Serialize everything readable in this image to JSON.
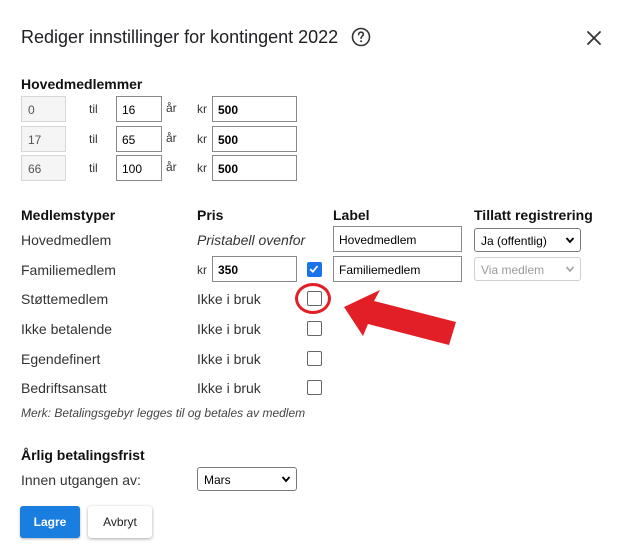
{
  "dialog": {
    "title": "Rediger innstillinger for kontingent 2022",
    "close_icon": "close-icon",
    "help_icon": "help-circle-icon"
  },
  "main_members": {
    "heading": "Hovedmedlemmer",
    "rows": [
      {
        "from": "0",
        "til": "til",
        "to": "16",
        "unit": "år",
        "currency": "kr",
        "price": "500"
      },
      {
        "from": "17",
        "til": "til",
        "to": "65",
        "unit": "år",
        "currency": "kr",
        "price": "500"
      },
      {
        "from": "66",
        "til": "til",
        "to": "100",
        "unit": "år",
        "currency": "kr",
        "price": "500"
      }
    ]
  },
  "types": {
    "headers": {
      "type": "Medlemstyper",
      "price": "Pris",
      "label": "Label",
      "registration": "Tillatt registrering"
    },
    "rows": [
      {
        "name": "Hovedmedlem",
        "price": "Pristabell ovenfor",
        "label": "Hovedmedlem",
        "registration": "Ja (offentlig)",
        "checked": null
      },
      {
        "name": "Familiemedlem",
        "currency": "kr",
        "price": "350",
        "label": "Familiemedlem",
        "registration": "Via medlem",
        "checked": true
      },
      {
        "name": "Støttemedlem",
        "price": "Ikke i bruk",
        "checked": false
      },
      {
        "name": "Ikke betalende",
        "price": "Ikke i bruk",
        "checked": false
      },
      {
        "name": "Egendefinert",
        "price": "Ikke i bruk",
        "checked": false
      },
      {
        "name": "Bedriftsansatt",
        "price": "Ikke i bruk",
        "checked": false
      }
    ],
    "note": "Merk: Betalingsgebyr legges til og betales av medlem"
  },
  "deadline": {
    "heading": "Årlig betalingsfrist",
    "label": "Innen utgangen av:",
    "selected": "Mars"
  },
  "actions": {
    "save": "Lagre",
    "cancel": "Avbryt"
  },
  "colors": {
    "primary": "#1a7ee0",
    "checkbox_checked": "#1a73e8",
    "annotation": "#e21f26"
  }
}
